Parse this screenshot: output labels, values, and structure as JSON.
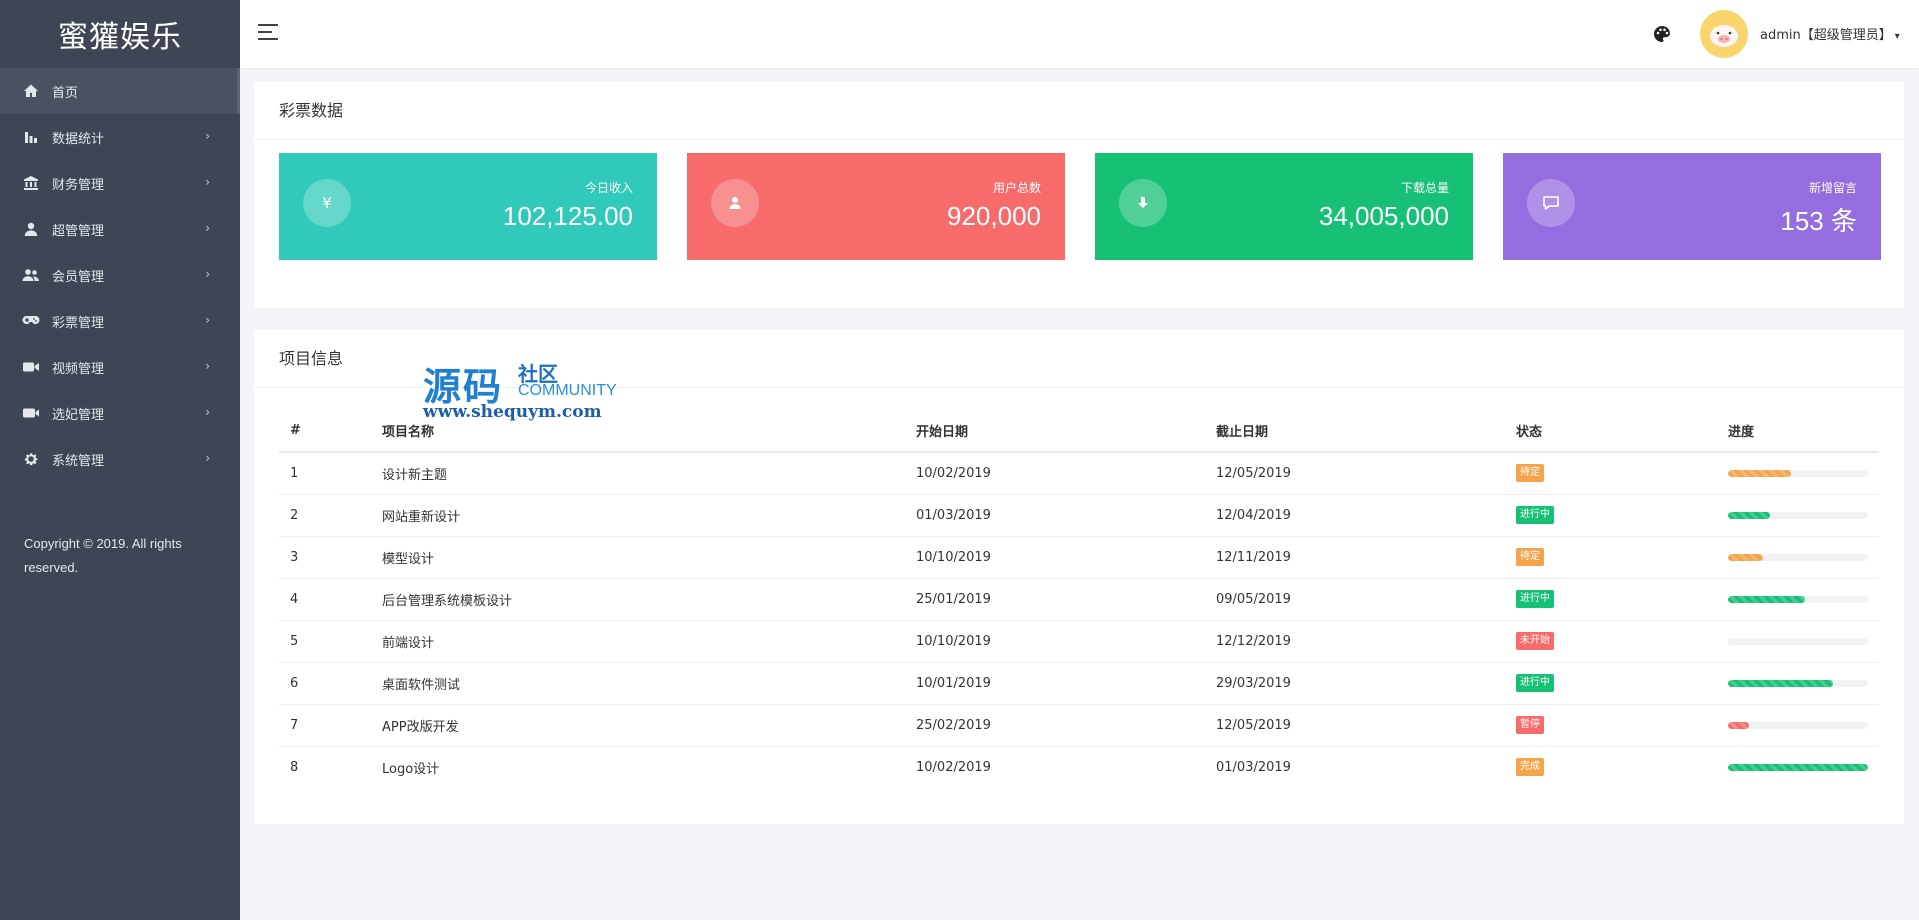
{
  "brand": "蜜獾娱乐",
  "sidebar": {
    "items": [
      {
        "label": "首页",
        "icon": "home-icon",
        "active": true,
        "chevron": false
      },
      {
        "label": "数据统计",
        "icon": "bar-chart-icon",
        "chevron": true
      },
      {
        "label": "财务管理",
        "icon": "bank-icon",
        "chevron": true
      },
      {
        "label": "超管管理",
        "icon": "user-icon",
        "chevron": true
      },
      {
        "label": "会员管理",
        "icon": "users-icon",
        "chevron": true
      },
      {
        "label": "彩票管理",
        "icon": "gamepad-icon",
        "chevron": true
      },
      {
        "label": "视频管理",
        "icon": "video-icon",
        "chevron": true
      },
      {
        "label": "选妃管理",
        "icon": "camera-icon",
        "chevron": true
      },
      {
        "label": "系统管理",
        "icon": "gear-icon",
        "chevron": true
      }
    ],
    "chevron_glyph": "›",
    "copyright": "Copyright © 2019. All rights reserved."
  },
  "topbar": {
    "user_label": "admin【超级管理员】",
    "caret": "▾"
  },
  "lottery_panel": {
    "title": "彩票数据",
    "stats": [
      {
        "label": "今日收入",
        "value": "102,125.00",
        "icon": "yen-icon",
        "color": "#31c9b9"
      },
      {
        "label": "用户总数",
        "value": "920,000",
        "icon": "user-icon",
        "color": "#f76b6b"
      },
      {
        "label": "下载总量",
        "value": "34,005,000",
        "icon": "download-icon",
        "color": "#16c075"
      },
      {
        "label": "新增留言",
        "value": "153 条",
        "icon": "message-icon",
        "color": "#946de0"
      }
    ]
  },
  "project_panel": {
    "title": "项目信息",
    "columns": [
      "#",
      "项目名称",
      "开始日期",
      "截止日期",
      "状态",
      "进度"
    ],
    "rows": [
      {
        "id": "1",
        "name": "设计新主题",
        "start": "10/02/2019",
        "end": "12/05/2019",
        "status": "待定",
        "status_color": "#f5a44c",
        "progress": 45,
        "bar_color": "#f5a44c"
      },
      {
        "id": "2",
        "name": "网站重新设计",
        "start": "01/03/2019",
        "end": "12/04/2019",
        "status": "进行中",
        "status_color": "#16c075",
        "progress": 30,
        "bar_color": "#16c075"
      },
      {
        "id": "3",
        "name": "模型设计",
        "start": "10/10/2019",
        "end": "12/11/2019",
        "status": "待定",
        "status_color": "#f5a44c",
        "progress": 25,
        "bar_color": "#f5a44c"
      },
      {
        "id": "4",
        "name": "后台管理系统模板设计",
        "start": "25/01/2019",
        "end": "09/05/2019",
        "status": "进行中",
        "status_color": "#16c075",
        "progress": 55,
        "bar_color": "#16c075"
      },
      {
        "id": "5",
        "name": "前端设计",
        "start": "10/10/2019",
        "end": "12/12/2019",
        "status": "未开始",
        "status_color": "#f76b6b",
        "progress": 0,
        "bar_color": "#f76b6b"
      },
      {
        "id": "6",
        "name": "桌面软件测试",
        "start": "10/01/2019",
        "end": "29/03/2019",
        "status": "进行中",
        "status_color": "#16c075",
        "progress": 75,
        "bar_color": "#16c075"
      },
      {
        "id": "7",
        "name": "APP改版开发",
        "start": "25/02/2019",
        "end": "12/05/2019",
        "status": "暂停",
        "status_color": "#f76b6b",
        "progress": 15,
        "bar_color": "#f76b6b"
      },
      {
        "id": "8",
        "name": "Logo设计",
        "start": "10/02/2019",
        "end": "01/03/2019",
        "status": "完成",
        "status_color": "#f5a44c",
        "progress": 100,
        "bar_color": "#16c075"
      }
    ]
  },
  "watermark": {
    "big": "源码",
    "small": "社区",
    "community": "COMMUNITY",
    "url": "www.shequym.com"
  }
}
